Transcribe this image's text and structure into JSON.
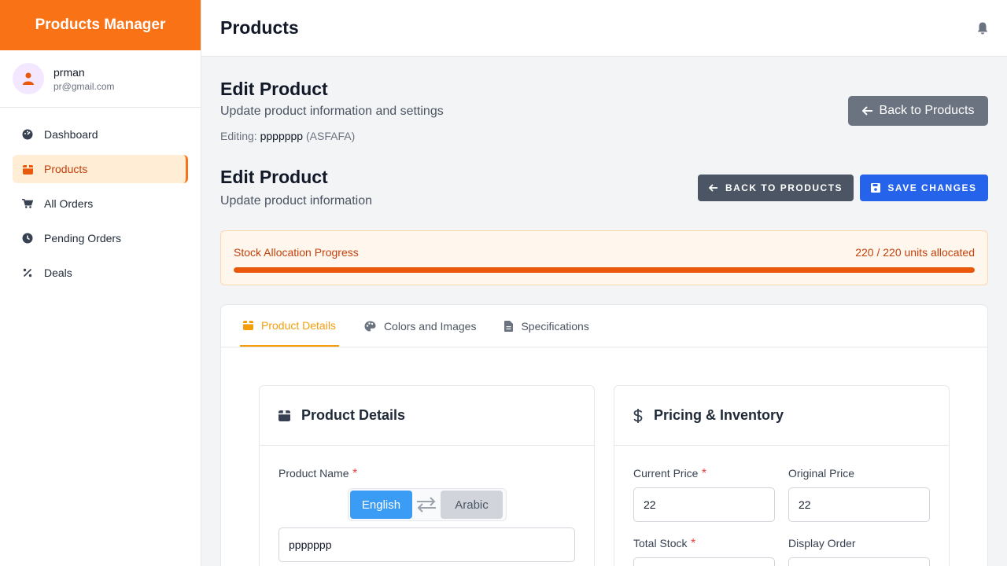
{
  "app": {
    "brand": "Products Manager"
  },
  "user": {
    "name": "prman",
    "email": "pr@gmail.com"
  },
  "nav": {
    "dashboard": "Dashboard",
    "products": "Products",
    "all_orders": "All Orders",
    "pending_orders": "Pending Orders",
    "deals": "Deals"
  },
  "header": {
    "title": "Products"
  },
  "page": {
    "title": "Edit Product",
    "subtitle": "Update product information and settings",
    "editing_label": "Editing:",
    "editing_name": "ppppppp",
    "editing_code": "(ASFAFA)",
    "back_button": "Back to Products"
  },
  "form_header": {
    "title": "Edit Product",
    "subtitle": "Update product information",
    "back_button": "BACK TO PRODUCTS",
    "save_button": "SAVE CHANGES"
  },
  "stock": {
    "label": "Stock Allocation Progress",
    "status": "220 / 220 units allocated",
    "allocated": 220,
    "total": 220
  },
  "tabs": [
    "Product Details",
    "Colors and Images",
    "Specifications"
  ],
  "product_details": {
    "title": "Product Details",
    "name_label": "Product Name",
    "required": "*",
    "lang_english": "English",
    "lang_arabic": "Arabic",
    "name_value": "ppppppp"
  },
  "pricing": {
    "title": "Pricing & Inventory",
    "current_price_label": "Current Price",
    "current_price_value": "22",
    "original_price_label": "Original Price",
    "original_price_value": "22",
    "total_stock_label": "Total Stock",
    "display_order_label": "Display Order",
    "required": "*"
  },
  "colors": {
    "brand": "#f97316",
    "primary": "#2563eb",
    "tab_active": "#f59e0b"
  }
}
